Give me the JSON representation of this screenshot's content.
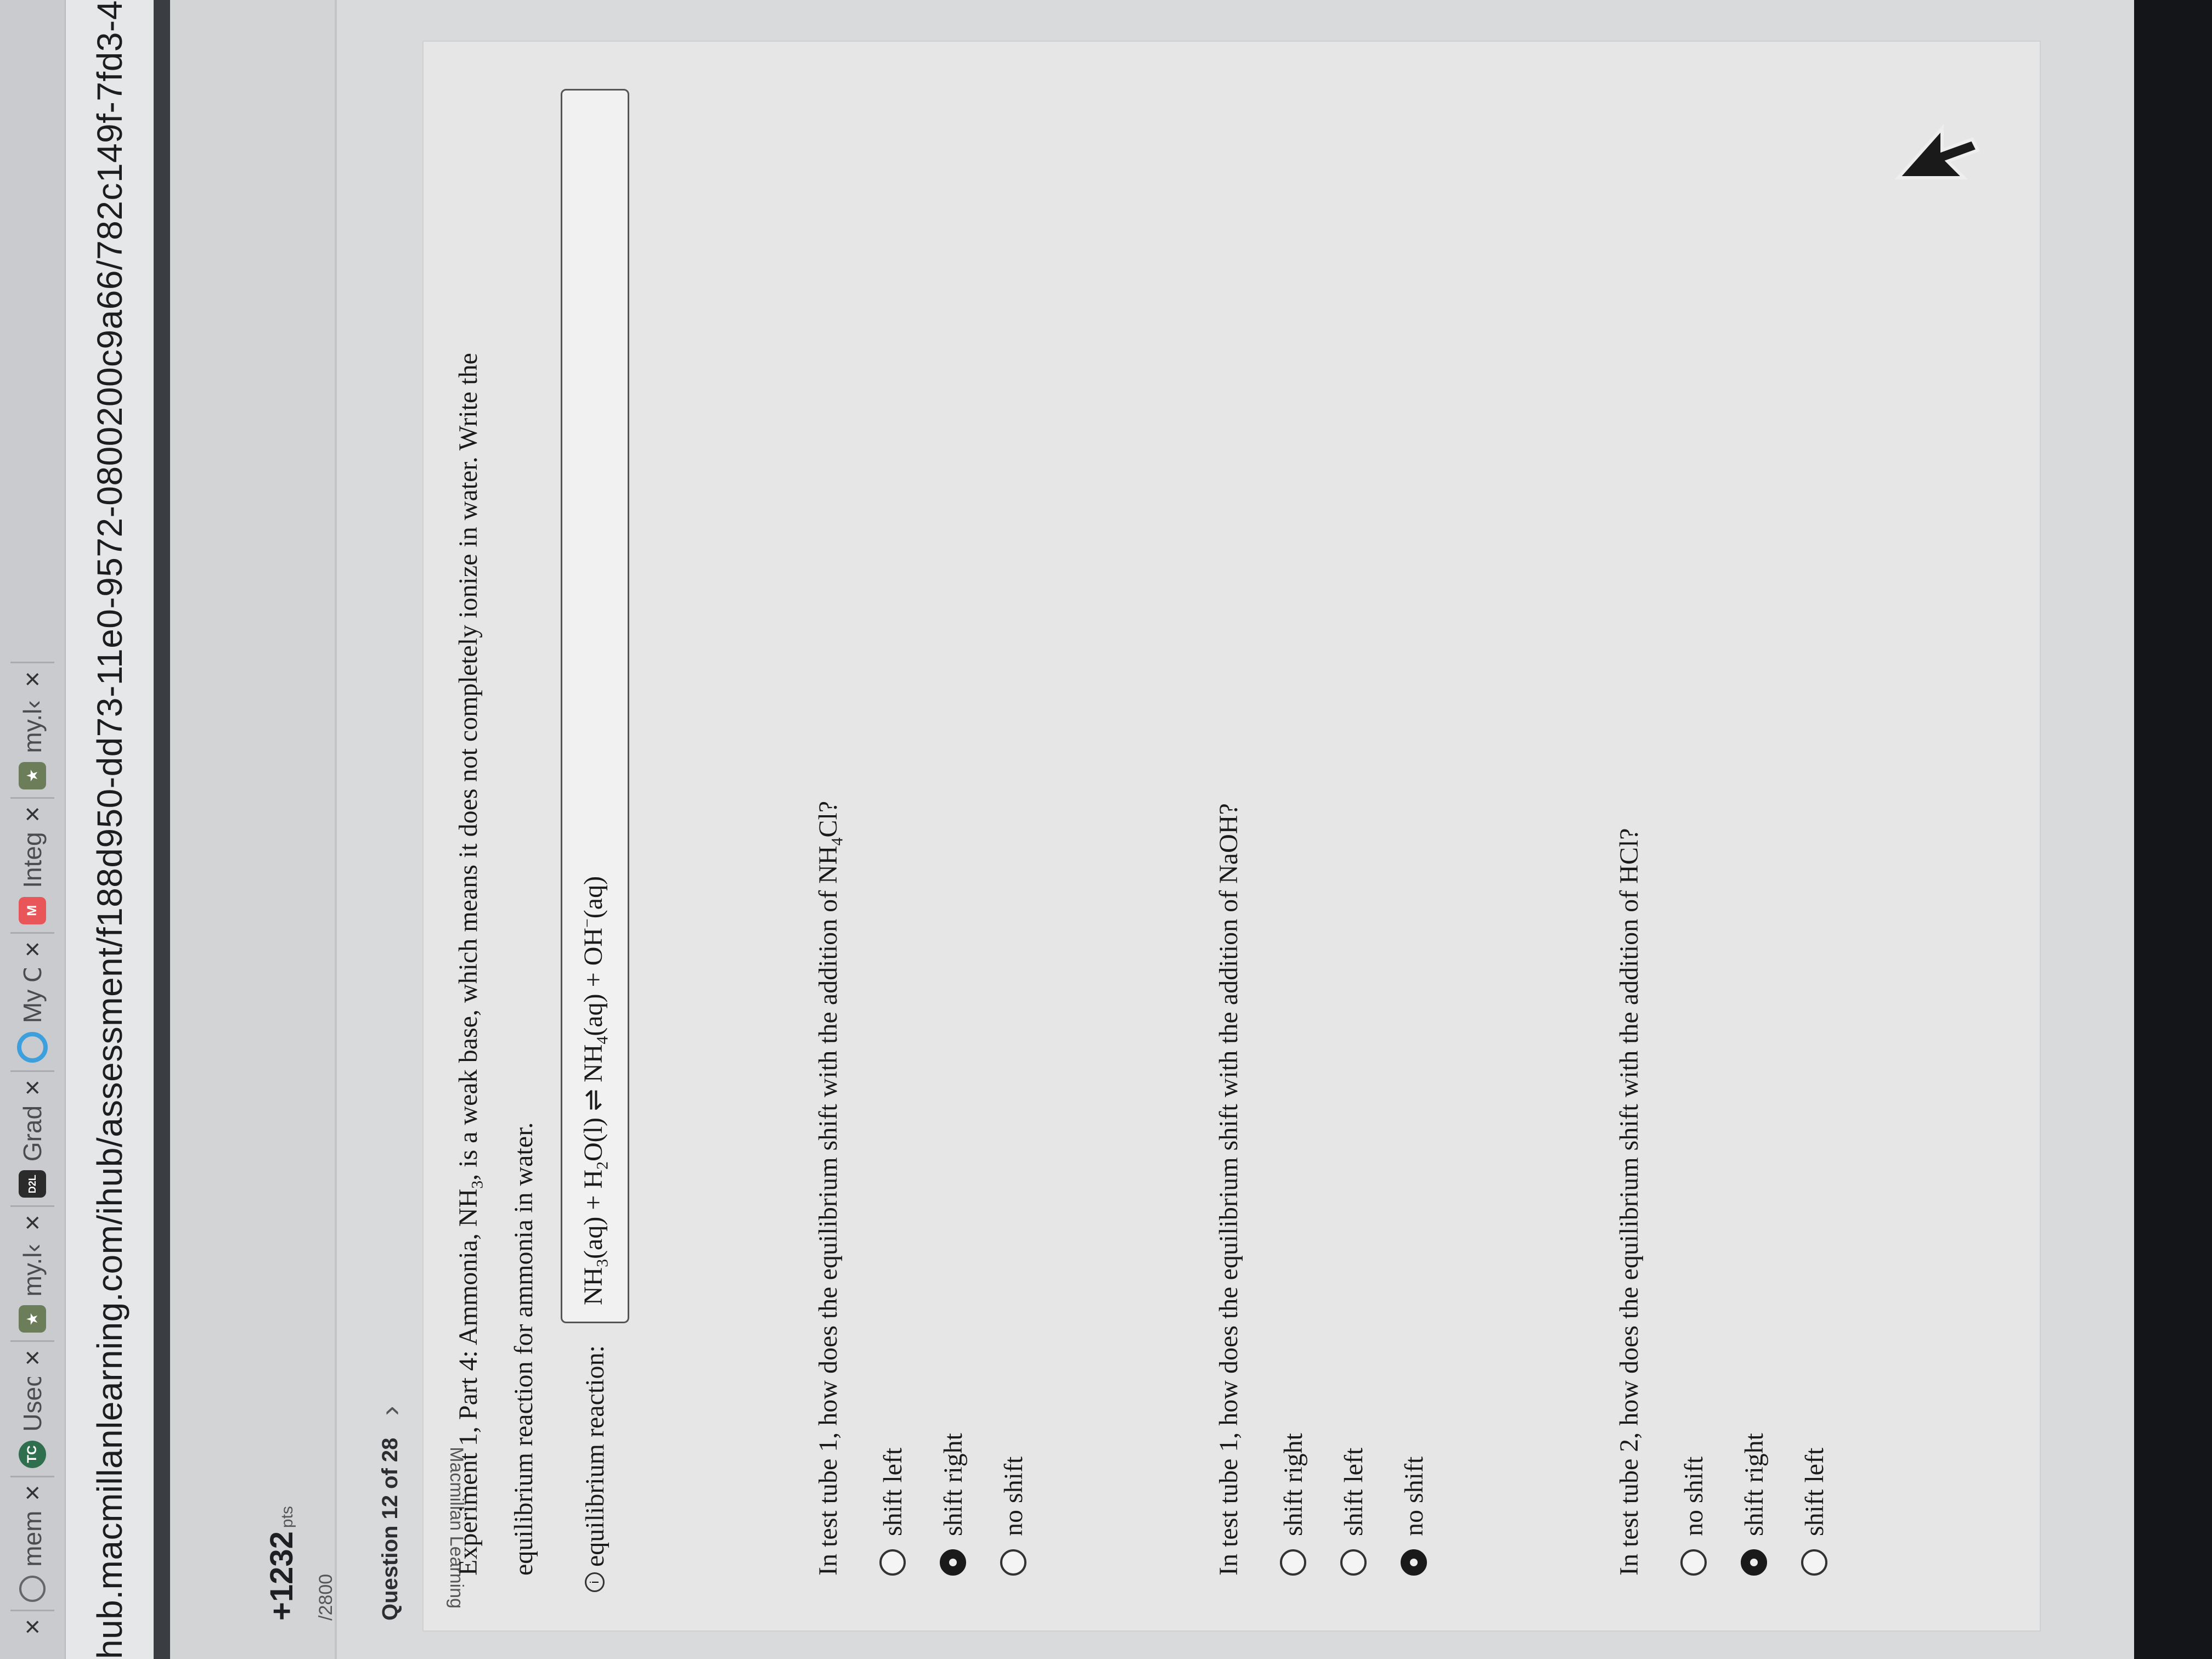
{
  "browser": {
    "tabs": [
      {
        "title": "mem",
        "favicon_text": "",
        "favicon_color": "#ffffff"
      },
      {
        "title": "Usec",
        "favicon_text": "TC",
        "favicon_color": "#2f6f4e"
      },
      {
        "title": "my.l‹",
        "favicon_text": "★",
        "favicon_color": "#6b7d59"
      },
      {
        "title": "Grad",
        "favicon_text": "D2L",
        "favicon_color": "#2b2b2b"
      },
      {
        "title": "My C",
        "favicon_text": "O",
        "favicon_color": "#3da0dc"
      },
      {
        "title": "Integ",
        "favicon_text": "M",
        "favicon_color": "#e8565a"
      },
      {
        "title": "my.l‹",
        "favicon_text": "★",
        "favicon_color": "#6b7d59"
      }
    ],
    "close_glyph": "×",
    "url": "hub.macmillanlearning.com/ihub/assessment/f188d950-dd73-11e0-9572-0800200c9a66/782c149f-7fd3-4363-"
  },
  "sidebar": {
    "score": "+1232",
    "score_unit": "pts",
    "score_total": "/2800",
    "question_label": "Question 12 of 28",
    "next_glyph": "›"
  },
  "question": {
    "watermark": "Macmillan Learning",
    "intro_a": "Experiment 1, Part 4: Ammonia, NH",
    "intro_a_sub": "3",
    "intro_b": ", is a weak base, which means it does not completely ionize in water. Write the",
    "intro_c": "equilibrium reaction for ammonia in water.",
    "eq_label": "equilibrium reaction:",
    "eq": {
      "t1": "NH",
      "s1": "3",
      "t2": "(aq) + H",
      "s2": "2",
      "t3": "O(l) ",
      "arrow": "⇌",
      "t4": " NH",
      "s4": "4",
      "t5": "(aq) + OH",
      "sup5": "−",
      "t6": "(aq)"
    },
    "parts": [
      {
        "prompt_a": "In test tube 1, how does the equilibrium shift with the addition of NH",
        "prompt_sub": "4",
        "prompt_b": "Cl?",
        "options": [
          {
            "label": "shift left",
            "selected": false
          },
          {
            "label": "shift right",
            "selected": true
          },
          {
            "label": "no shift",
            "selected": false
          }
        ]
      },
      {
        "prompt_a": "In test tube 1, how does the equilibrium shift with the addition of NaOH?",
        "prompt_sub": "",
        "prompt_b": "",
        "options": [
          {
            "label": "shift right",
            "selected": false
          },
          {
            "label": "shift left",
            "selected": false
          },
          {
            "label": "no shift",
            "selected": true
          }
        ]
      },
      {
        "prompt_a": "In test tube 2, how does the equilibrium shift with the addition of HCl?",
        "prompt_sub": "",
        "prompt_b": "",
        "options": [
          {
            "label": "no shift",
            "selected": false
          },
          {
            "label": "shift right",
            "selected": true
          },
          {
            "label": "shift left",
            "selected": false
          }
        ]
      }
    ]
  }
}
